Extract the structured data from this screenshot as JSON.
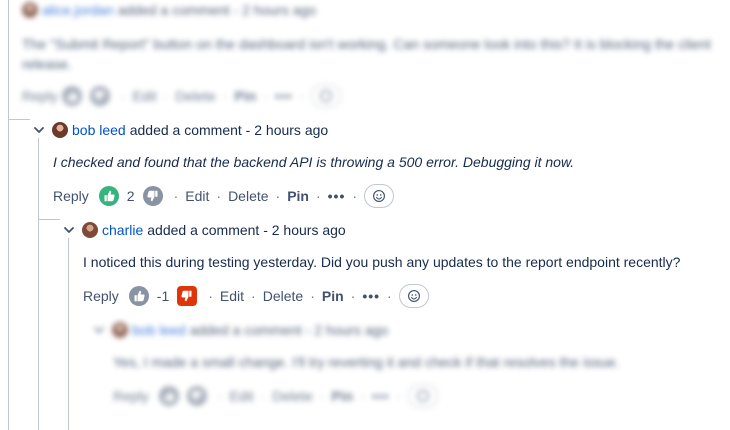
{
  "top_comment": {
    "author": "alice.jordan",
    "meta": "added a comment - 2 hours ago",
    "body": "The \"Submit Report\" button on the dashboard isn't working. Can someone look into this? It is blocking the client release.",
    "actions": {
      "reply": "Reply",
      "edit": "Edit",
      "delete": "Delete",
      "pin": "Pin",
      "more": "•••"
    }
  },
  "comment_bob": {
    "author": "bob leed",
    "meta": "added a comment - 2 hours ago",
    "body": "I checked and found that the backend API is throwing a 500 error. Debugging it now.",
    "vote_count": "2",
    "actions": {
      "reply": "Reply",
      "edit": "Edit",
      "delete": "Delete",
      "pin": "Pin",
      "more": "•••"
    }
  },
  "comment_charlie": {
    "author": "charlie",
    "meta": "added a comment - 2 hours ago",
    "body": "I noticed this during testing yesterday. Did you push any updates to the report endpoint recently?",
    "vote_count": "-1",
    "actions": {
      "reply": "Reply",
      "edit": "Edit",
      "delete": "Delete",
      "pin": "Pin",
      "more": "•••"
    }
  },
  "comment_bob_reply": {
    "author": "bob leed",
    "meta": "added a comment - 2 hours ago",
    "body": "Yes, I made a small change. I'll try reverting it and check if that resolves the issue.",
    "actions": {
      "reply": "Reply",
      "edit": "Edit",
      "delete": "Delete",
      "pin": "Pin",
      "more": "•••"
    }
  },
  "colors": {
    "link": "#0052cc",
    "upvote": "#36b37e",
    "downvote_active": "#de350b",
    "neutral": "#8993a4"
  },
  "icons": {
    "expand": "chevron-down-icon",
    "up": "thumbs-up-icon",
    "down": "thumbs-down-icon",
    "react": "add-reaction-icon"
  }
}
